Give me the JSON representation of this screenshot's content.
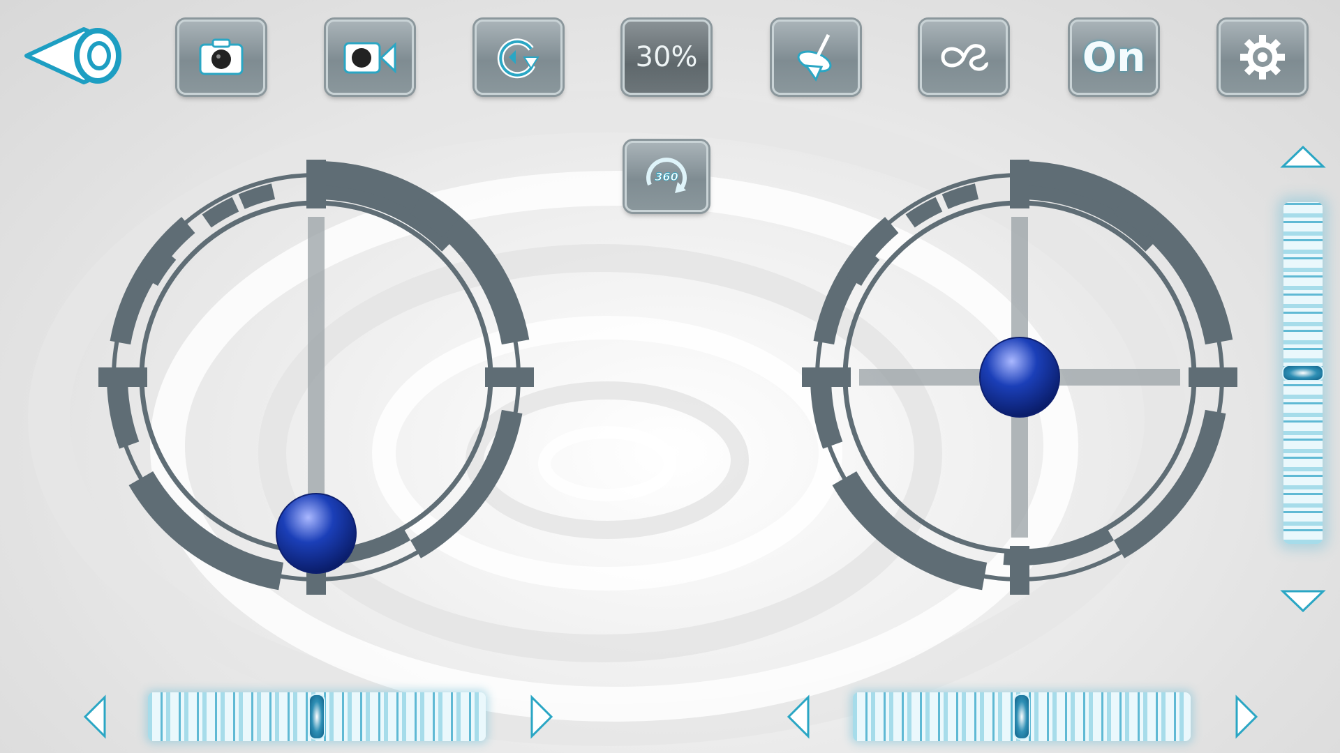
{
  "toolbar": {
    "back_icon": "back-eye-icon",
    "buttons": [
      {
        "name": "photo",
        "icon": "camera-icon"
      },
      {
        "name": "video",
        "icon": "video-camera-icon"
      },
      {
        "name": "flip",
        "icon": "rotate-icon"
      },
      {
        "name": "speed",
        "label": "30%"
      },
      {
        "name": "gyro-calibrate",
        "icon": "spinning-top-icon"
      },
      {
        "name": "headless",
        "icon": "headless-mode-icon"
      },
      {
        "name": "power",
        "label": "On"
      },
      {
        "name": "settings",
        "icon": "gear-icon"
      }
    ],
    "flip360_label": "360"
  },
  "left_stick": {
    "x": 0.0,
    "y": -1.0
  },
  "right_stick": {
    "x": 0.0,
    "y": 0.0
  },
  "trim": {
    "vertical": 0.5,
    "left_horizontal": 0.5,
    "right_horizontal": 0.5
  },
  "colors": {
    "accent": "#2aa6c4",
    "frame": "#5f6d75",
    "ball": "#1b3fb8"
  }
}
